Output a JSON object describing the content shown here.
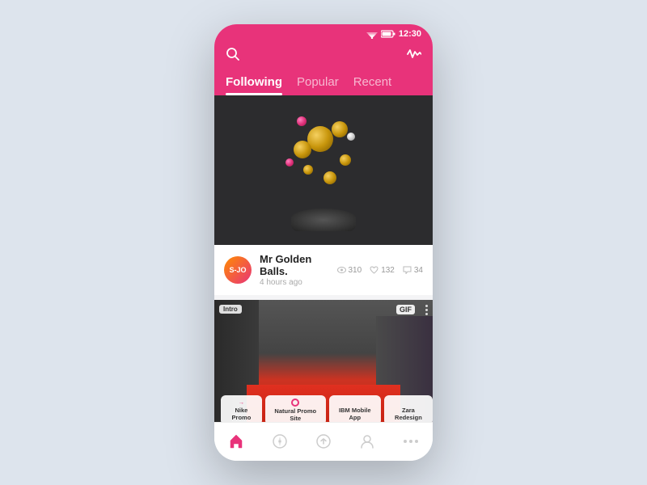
{
  "statusBar": {
    "time": "12:30"
  },
  "tabs": [
    {
      "id": "following",
      "label": "Following",
      "active": true
    },
    {
      "id": "popular",
      "label": "Popular",
      "active": false
    },
    {
      "id": "recent",
      "label": "Recent",
      "active": false
    }
  ],
  "posts": [
    {
      "id": "post1",
      "title": "Mr Golden Balls.",
      "timeAgo": "4 hours ago",
      "views": "310",
      "likes": "132",
      "comments": "34",
      "avatarText": "S-JO"
    },
    {
      "id": "post2",
      "chips": [
        {
          "label": "Nike Promo",
          "icon": "arrow"
        },
        {
          "label": "Natural Promo Site",
          "icon": "circle"
        },
        {
          "label": "IBM Mobile App",
          "icon": null
        },
        {
          "label": "Zara Redesign",
          "icon": null
        }
      ],
      "gifBadge": "GIF",
      "introBadge": "Intro"
    }
  ],
  "nav": {
    "items": [
      {
        "id": "home",
        "icon": "home",
        "active": true
      },
      {
        "id": "explore",
        "icon": "compass",
        "active": false
      },
      {
        "id": "upload",
        "icon": "upload",
        "active": false
      },
      {
        "id": "profile",
        "icon": "user",
        "active": false
      },
      {
        "id": "more",
        "icon": "dots",
        "active": false
      }
    ]
  }
}
